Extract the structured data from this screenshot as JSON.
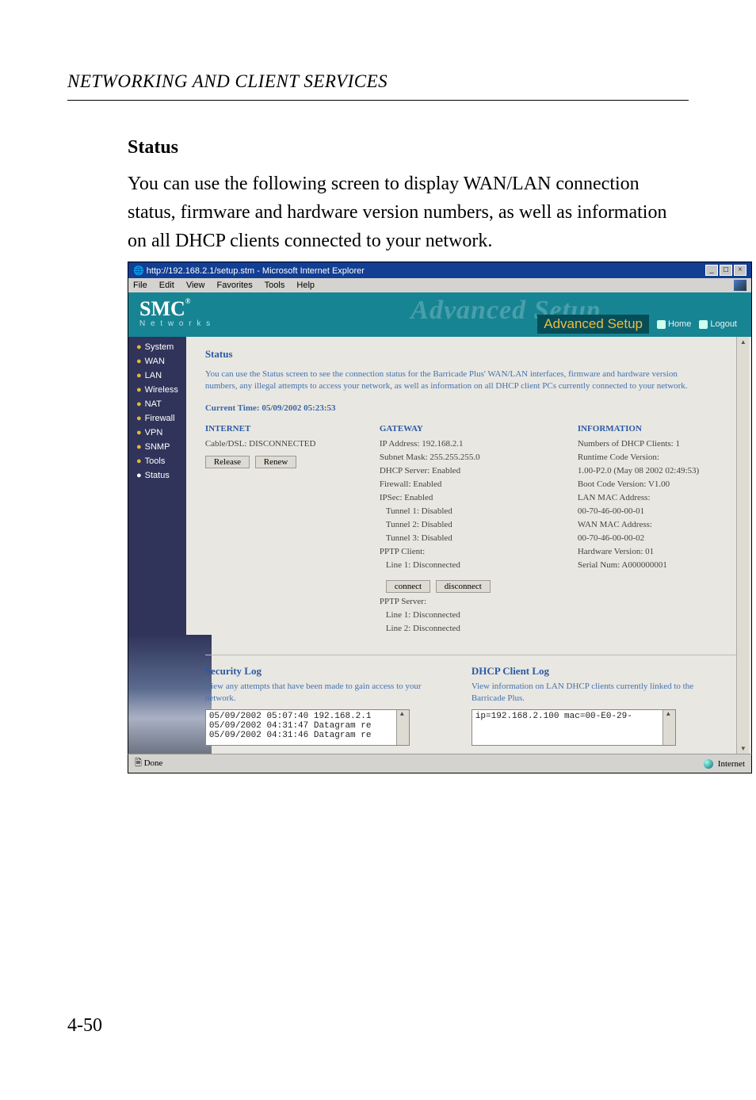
{
  "doc": {
    "chapter_header": "NETWORKING AND CLIENT SERVICES",
    "section_title": "Status",
    "body_paragraph": "You can use the following screen to display WAN/LAN connection status, firmware and hardware version numbers, as well as information on all DHCP clients connected to your network.",
    "page_number": "4-50"
  },
  "browser": {
    "title": "http://192.168.2.1/setup.stm - Microsoft Internet Explorer",
    "menus": [
      "File",
      "Edit",
      "View",
      "Favorites",
      "Tools",
      "Help"
    ],
    "status_left": "Done",
    "status_right": "Internet"
  },
  "app": {
    "logo": "SMC",
    "logo_reg": "®",
    "logo_sub": "N e t w o r k s",
    "ghost": "Advanced Setup",
    "adv_setup": "Advanced Setup",
    "home": "Home",
    "logout": "Logout"
  },
  "sidebar": {
    "items": [
      "System",
      "WAN",
      "LAN",
      "Wireless",
      "NAT",
      "Firewall",
      "VPN",
      "SNMP",
      "Tools",
      "Status"
    ]
  },
  "status": {
    "title": "Status",
    "intro": "You can use the Status screen to see the connection status for the Barricade Plus' WAN/LAN interfaces, firmware and hardware version numbers, any illegal attempts to access your network, as well as information on all DHCP client PCs currently connected to your network.",
    "current_time_label": "Current Time: 05/09/2002 05:23:53",
    "internet": {
      "heading": "INTERNET",
      "line1": "Cable/DSL:  DISCONNECTED",
      "btn_release": "Release",
      "btn_renew": "Renew"
    },
    "gateway": {
      "heading": "GATEWAY",
      "lines": [
        "IP Address:  192.168.2.1",
        "Subnet Mask:  255.255.255.0",
        "DHCP Server:  Enabled",
        "Firewall:  Enabled",
        "IPSec:  Enabled",
        "  Tunnel 1: Disabled",
        "  Tunnel 2: Disabled",
        "  Tunnel 3: Disabled",
        "PPTP Client:",
        "  Line 1:  Disconnected"
      ],
      "btn_connect": "connect",
      "btn_disconnect": "disconnect",
      "lines2": [
        "PPTP Server:",
        "  Line 1:  Disconnected",
        "  Line 2:  Disconnected"
      ]
    },
    "information": {
      "heading": "INFORMATION",
      "lines": [
        "Numbers of DHCP Clients:  1",
        "Runtime Code Version:",
        "   1.00-P2.0 (May 08 2002 02:49:53)",
        "Boot Code Version:  V1.00",
        "LAN MAC Address:",
        "   00-70-46-00-00-01",
        "WAN MAC Address:",
        "   00-70-46-00-00-02",
        "Hardware Version:  01",
        "Serial Num:  A000000001"
      ]
    },
    "security_log": {
      "heading": "Security Log",
      "desc": "View any attempts that have been made to gain access to your network.",
      "lines": [
        "05/09/2002  05:07:40 192.168.2.1",
        "05/09/2002  04:31:47 Datagram re",
        "05/09/2002  04:31:46 Datagram re"
      ]
    },
    "dhcp_log": {
      "heading": "DHCP Client Log",
      "desc": "View information on LAN DHCP clients currently linked to the Barricade Plus.",
      "lines": [
        "ip=192.168.2.100    mac=00-E0-29-"
      ]
    }
  }
}
